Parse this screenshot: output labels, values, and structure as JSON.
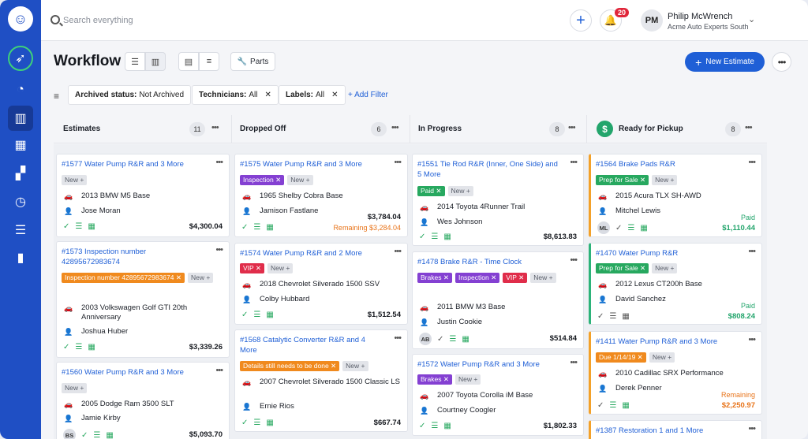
{
  "topbar": {
    "search_placeholder": "Search everything",
    "notifications_count": "20",
    "user_initials": "PM",
    "user_name": "Philip McWrench",
    "user_org": "Acme Auto Experts South"
  },
  "header": {
    "title": "Workflow",
    "parts_label": "Parts",
    "new_estimate_label": "New Estimate"
  },
  "filters": [
    {
      "label": "Archived status:",
      "value": "Not Archived"
    },
    {
      "label": "Technicians:",
      "value": "All"
    },
    {
      "label": "Labels:",
      "value": "All"
    }
  ],
  "add_filter_label": "+ Add Filter",
  "columns": [
    {
      "name": "Estimates",
      "count": "11"
    },
    {
      "name": "Dropped Off",
      "count": "6"
    },
    {
      "name": "In Progress",
      "count": "8"
    },
    {
      "name": "Ready for Pickup",
      "count": "8"
    }
  ],
  "cards": {
    "c1": {
      "title": "#1577 Water Pump R&R and 3 More",
      "tags": [
        "New +"
      ],
      "vehicle": "2013 BMW M5 Base",
      "customer": "Jose Moran",
      "amount": "$4,300.04"
    },
    "c2": {
      "title": "#1573 Inspection number 42895672983674",
      "tags": [
        "Inspection number 42895672983674 ✕",
        "New +"
      ],
      "vehicle": "2003 Volkswagen Golf GTI 20th Anniversary",
      "customer": "Joshua Huber",
      "amount": "$3,339.26"
    },
    "c3": {
      "title": "#1560 Water Pump R&R and 3 More",
      "tags": [
        "New +"
      ],
      "vehicle": "2005 Dodge Ram 3500 SLT",
      "customer": "Jamie Kirby",
      "avatar": "BS",
      "amount": "$5,093.70"
    },
    "c4": {
      "title": "#1575 Water Pump R&R and 3 More",
      "tags": [
        "Inspection ✕",
        "New +"
      ],
      "vehicle": "1965 Shelby Cobra Base",
      "customer": "Jamison Fastlane",
      "amount": "$3,784.04",
      "sub": "Remaining $3,284.04"
    },
    "c5": {
      "title": "#1574 Water Pump R&R and 2 More",
      "tags": [
        "VIP ✕",
        "New +"
      ],
      "vehicle": "2018 Chevrolet Silverado 1500 SSV",
      "customer": "Colby Hubbard",
      "amount": "$1,512.54"
    },
    "c6": {
      "title": "#1568 Catalytic Converter R&R and 4 More",
      "tags": [
        "Details still needs to be done ✕",
        "New +"
      ],
      "vehicle": "2007 Chevrolet Silverado 1500 Classic LS",
      "customer": "Ernie Rios",
      "amount": "$667.74"
    },
    "c7": {
      "title": "#1551 Tie Rod R&R (Inner, One Side) and 5 More",
      "tags": [
        "Paid ✕",
        "New +"
      ],
      "vehicle": "2014 Toyota 4Runner Trail",
      "customer": "Wes Johnson",
      "amount": "$8,613.83"
    },
    "c8": {
      "title": "#1478 Brake R&R - Time Clock",
      "tags": [
        "Brakes ✕",
        "Inspection ✕",
        "VIP ✕",
        "New +"
      ],
      "vehicle": "2011 BMW M3 Base",
      "customer": "Justin Cookie",
      "avatar": "AB",
      "amount": "$514.84"
    },
    "c9": {
      "title": "#1572 Water Pump R&R and 3 More",
      "tags": [
        "Brakes ✕",
        "New +"
      ],
      "vehicle": "2007 Toyota Corolla iM Base",
      "customer": "Courtney Coogler",
      "amount": "$1,802.33"
    },
    "c10": {
      "title": "#1564 Brake Pads R&R",
      "tags": [
        "Prep for Sale ✕",
        "New +"
      ],
      "vehicle": "2015 Acura TLX SH-AWD",
      "customer": "Mitchel Lewis",
      "avatar": "ML",
      "status": "Paid",
      "amount": "$1,110.44"
    },
    "c11": {
      "title": "#1470 Water Pump R&R",
      "tags": [
        "Prep for Sale ✕",
        "New +"
      ],
      "vehicle": "2012 Lexus CT200h Base",
      "customer": "David Sanchez",
      "status": "Paid",
      "amount": "$808.24"
    },
    "c12": {
      "title": "#1411 Water Pump R&R and 3 More",
      "tags": [
        "Due 1/14/19 ✕",
        "New +"
      ],
      "vehicle": "2010 Cadillac SRX Performance",
      "customer": "Derek Penner",
      "status": "Remaining",
      "amount": "$2,250.97"
    },
    "c13": {
      "title": "#1387 Restoration 1 and 1 More"
    }
  },
  "colors": {
    "sidebar": "#1f4fc4",
    "accent": "#1f5fd6",
    "success": "#27a85f",
    "warning": "#f08a1e",
    "danger": "#e02d4a",
    "purple": "#8440d2"
  },
  "icons": [
    "monkey-logo-icon",
    "rocket-icon",
    "gauge-icon",
    "kanban-icon",
    "calendar-icon",
    "grid-icon",
    "clock-icon",
    "list-icon",
    "bar-chart-icon"
  ]
}
